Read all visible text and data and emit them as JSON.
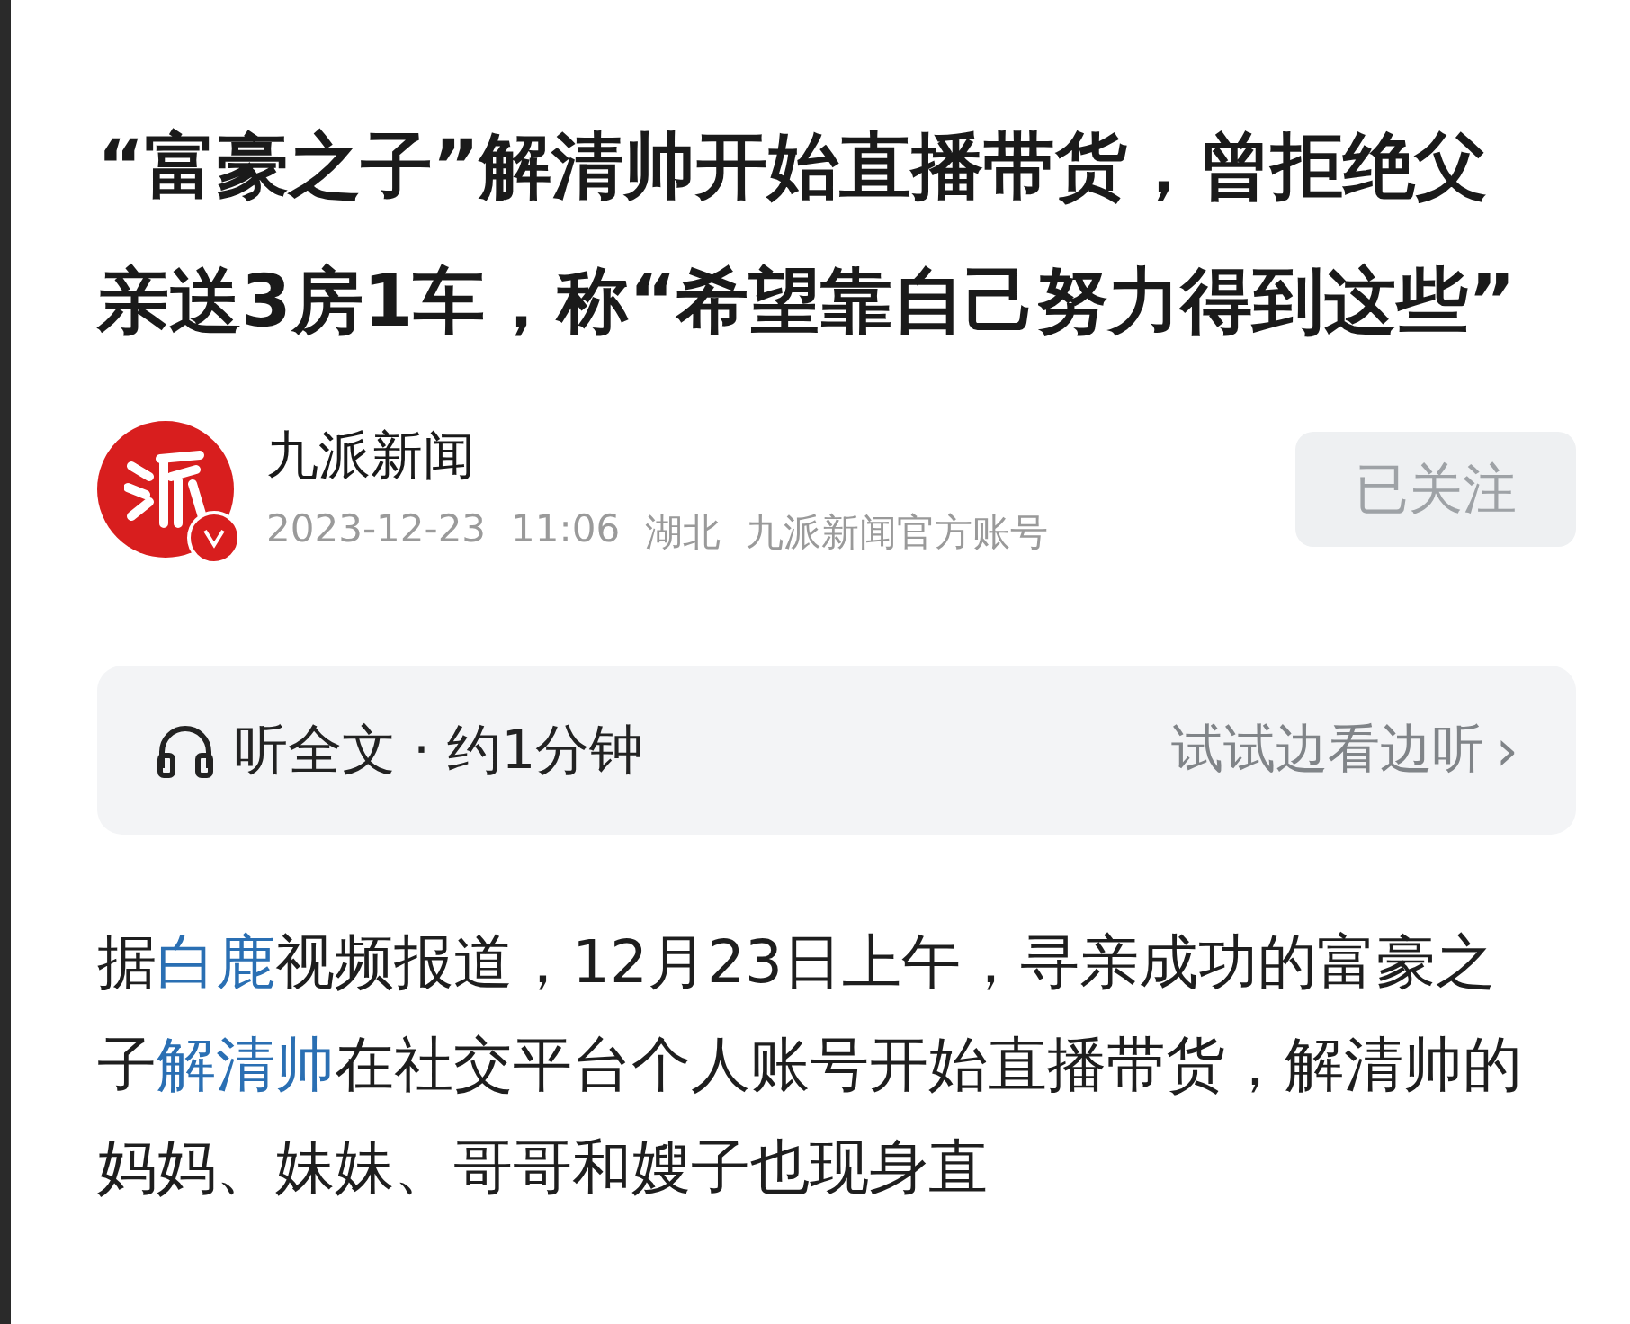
{
  "article": {
    "title": "“富豪之子”解清帅开始直播带货，曾拒绝父亲送3房1车，称“希望靠自己努力得到这些”",
    "author": {
      "name": "九派新闻",
      "date": "2023-12-23",
      "time": "11:06",
      "location": "湖北",
      "account": "九派新闻官方账号",
      "verified": true
    },
    "follow_button": {
      "label": "已关注",
      "followed": true
    },
    "listen": {
      "label": "听全文 · 约1分钟",
      "action": "试试边看边听",
      "chevron": "›"
    },
    "body": [
      {
        "text": "据",
        "link": false
      },
      {
        "text": "白鹿",
        "link": true
      },
      {
        "text": "视频报道，12月23日上午，寻亲成功的富豪之子",
        "link": false
      },
      {
        "text": "解清帅",
        "link": true
      },
      {
        "text": "在社交平台个人账号开始直播带货，解清帅的妈妈、妹妹、哥哥和嫂子也现身直",
        "link": false
      }
    ]
  }
}
